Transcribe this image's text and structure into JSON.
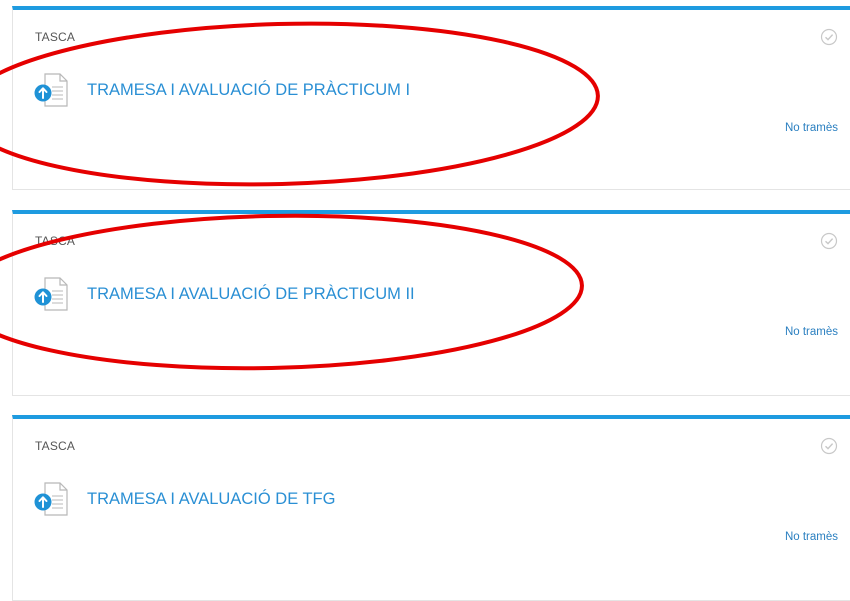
{
  "activities": [
    {
      "type_label": "TASCA",
      "name": "TRAMESA I AVALUACIÓ DE PRÀCTICUM I",
      "status": "No tramès",
      "icon": "assignment-upload-icon"
    },
    {
      "type_label": "TASCA",
      "name": "TRAMESA I AVALUACIÓ DE PRÀCTICUM II",
      "status": "No tramès",
      "icon": "assignment-upload-icon"
    },
    {
      "type_label": "TASCA",
      "name": "TRAMESA I AVALUACIÓ DE TFG",
      "status": "No tramès",
      "icon": "assignment-upload-icon"
    }
  ],
  "colors": {
    "accent": "#1e9be0",
    "link": "#2a8fd4",
    "annotation": "#e50000"
  }
}
